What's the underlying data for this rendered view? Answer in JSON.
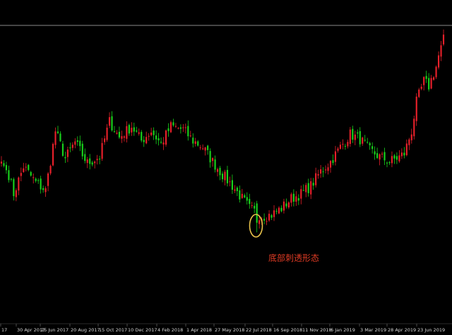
{
  "colors": {
    "background": "#000000",
    "up": "#e8202a",
    "down": "#18d21c",
    "annotation": "#e03b24",
    "highlight_ring": "#e8c24a",
    "reference_line": "#b9b9b9",
    "axis_text": "#d8d8d8"
  },
  "chart_data": {
    "type": "candlestick",
    "title": "",
    "xlabel": "",
    "ylabel": "",
    "grid": false,
    "legend": "none",
    "x_tick_labels": [
      "17",
      "30 Apr 2017",
      "25 Jun 2017",
      "20 Aug 2017",
      "15 Oct 2017",
      "10 Dec 2017",
      "4 Feb 2018",
      "1 Apr 2018",
      "27 May 2018",
      "22 Jul 2018",
      "16 Sep 2018",
      "11 Nov 2018",
      "6 Jan 2019",
      "3 Mar 2019",
      "28 Apr 2019",
      "23 Jun 2019"
    ],
    "annotation": {
      "text": "底部刺透形态",
      "marks_candle_index": 104
    },
    "close_anchors": [
      [
        0,
        53
      ],
      [
        3,
        45
      ],
      [
        5,
        33
      ],
      [
        9,
        50
      ],
      [
        14,
        40
      ],
      [
        18,
        35
      ],
      [
        22,
        72
      ],
      [
        26,
        55
      ],
      [
        30,
        65
      ],
      [
        35,
        52
      ],
      [
        40,
        56
      ],
      [
        44,
        78
      ],
      [
        48,
        68
      ],
      [
        53,
        75
      ],
      [
        57,
        66
      ],
      [
        61,
        72
      ],
      [
        65,
        64
      ],
      [
        69,
        75
      ],
      [
        74,
        73
      ],
      [
        78,
        66
      ],
      [
        82,
        62
      ],
      [
        86,
        53
      ],
      [
        90,
        45
      ],
      [
        94,
        38
      ],
      [
        98,
        30
      ],
      [
        101,
        24
      ],
      [
        104,
        21
      ],
      [
        106,
        19
      ],
      [
        110,
        20
      ],
      [
        114,
        24
      ],
      [
        118,
        30
      ],
      [
        122,
        33
      ],
      [
        126,
        38
      ],
      [
        130,
        47
      ],
      [
        134,
        53
      ],
      [
        138,
        62
      ],
      [
        142,
        70
      ],
      [
        146,
        67
      ],
      [
        150,
        60
      ],
      [
        154,
        56
      ],
      [
        158,
        53
      ],
      [
        162,
        56
      ],
      [
        164,
        58
      ],
      [
        167,
        72
      ],
      [
        169,
        90
      ],
      [
        172,
        103
      ],
      [
        174,
        100
      ],
      [
        177,
        112
      ],
      [
        180,
        132
      ]
    ]
  }
}
